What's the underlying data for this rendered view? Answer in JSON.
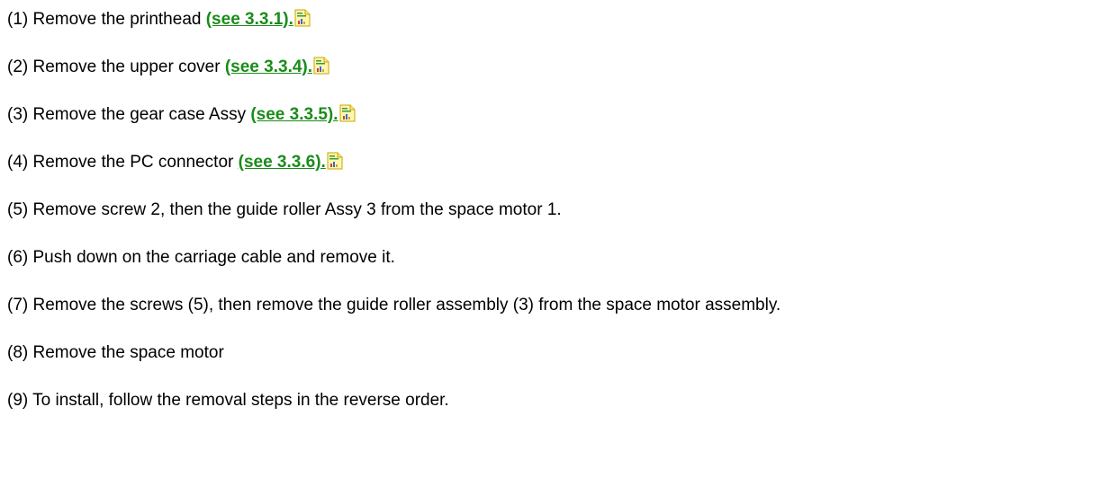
{
  "steps": [
    {
      "text": "(1) Remove the printhead ",
      "link": "(see 3.3.1).",
      "icon": "document-icon"
    },
    {
      "text": "(2) Remove the upper cover ",
      "link": "(see 3.3.4).",
      "icon": "document-icon"
    },
    {
      "text": "(3) Remove the gear case Assy ",
      "link": "(see 3.3.5).",
      "icon": "document-icon"
    },
    {
      "text": "(4) Remove the PC connector ",
      "link": "(see 3.3.6).",
      "icon": "document-icon"
    },
    {
      "text": "(5) Remove screw 2, then the guide roller Assy 3 from the space motor 1."
    },
    {
      "text": "(6) Push down on the carriage cable and remove it."
    },
    {
      "text": "(7) Remove the screws (5), then remove the guide roller assembly (3) from the space motor assembly."
    },
    {
      "text": "(8) Remove the space motor"
    },
    {
      "text": "(9) To install, follow the removal steps in the reverse order."
    }
  ],
  "colors": {
    "link": "#1a8c1a",
    "icon_body": "#fff7b0",
    "icon_border": "#c9a400"
  }
}
